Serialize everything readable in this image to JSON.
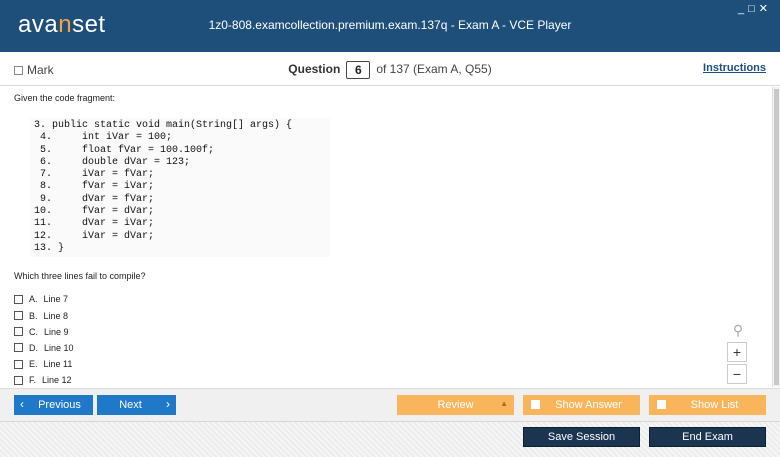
{
  "app": {
    "logo_pre": "ava",
    "logo_accent": "n",
    "logo_post": "set",
    "window_title": "1z0-808.examcollection.premium.exam.137q - Exam A - VCE Player",
    "controls": {
      "minimize": "_",
      "maximize": "□",
      "close": "✕"
    }
  },
  "qbar": {
    "mark_label": "Mark",
    "question_label": "Question",
    "question_value": "6",
    "question_suffix": "of 137 (Exam A, Q55)",
    "instructions_label": "Instructions"
  },
  "content": {
    "intro": "Given the code fragment:",
    "code": "3. public static void main(String[] args) {\n 4.     int iVar = 100;\n 5.     float fVar = 100.100f;\n 6.     double dVar = 123;\n 7.     iVar = fVar;\n 8.     fVar = iVar;\n 9.     dVar = fVar;\n10.     fVar = dVar;\n11.     dVar = iVar;\n12.     iVar = dVar;\n13. }",
    "question": "Which three lines fail to compile?",
    "options": [
      {
        "letter": "A.",
        "text": "Line 7"
      },
      {
        "letter": "B.",
        "text": "Line 8"
      },
      {
        "letter": "C.",
        "text": "Line 9"
      },
      {
        "letter": "D.",
        "text": "Line 10"
      },
      {
        "letter": "E.",
        "text": "Line 11"
      },
      {
        "letter": "F.",
        "text": "Line 12"
      }
    ]
  },
  "zoom": {
    "icon": "magnifier-icon",
    "plus": "+",
    "minus": "−"
  },
  "nav": {
    "previous": "Previous",
    "next": "Next",
    "review": "Review",
    "show_answer": "Show Answer",
    "show_list": "Show List",
    "save_session": "Save Session",
    "end_exam": "End Exam"
  },
  "colors": {
    "titlebar": "#1e4f7b",
    "accent": "#f7a23b",
    "nav_blue": "#1f78c8",
    "nav_orange": "#f8b55c",
    "dark_button": "#1b3550"
  }
}
